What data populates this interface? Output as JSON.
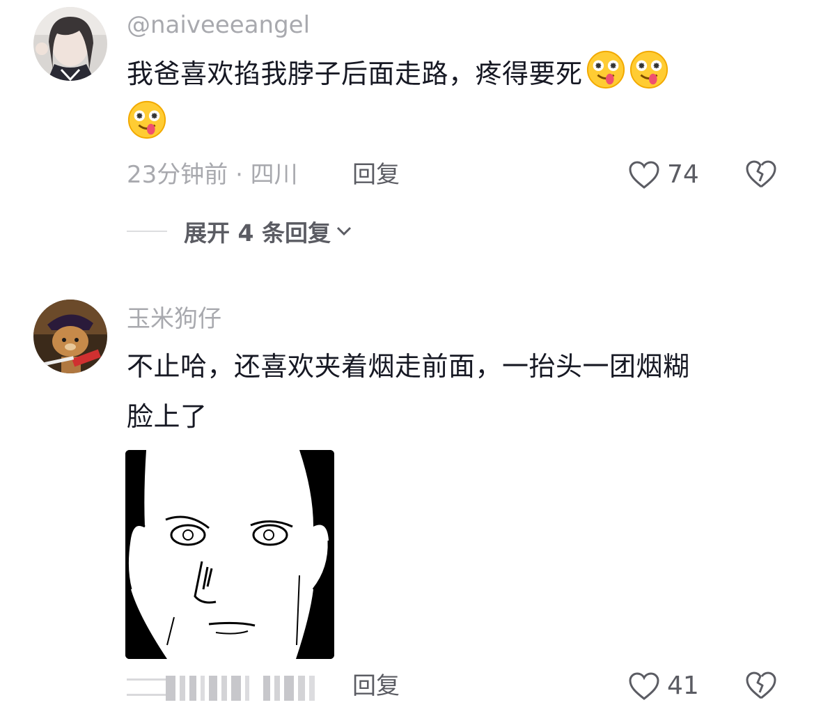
{
  "comments": [
    {
      "username": "@naiveeeangel",
      "text": "我爸喜欢掐我脖子后面走路，疼得要死",
      "emoji": [
        "drooling-face-emoji",
        "drooling-face-emoji",
        "drooling-face-emoji"
      ],
      "time_location": "23分钟前 · 四川",
      "reply_label": "回复",
      "likes": "74",
      "expand_replies": "展开 4 条回复"
    },
    {
      "username": "玉米狗仔",
      "text_line1": "不止哈，还喜欢夹着烟走前面，一抬头一团烟糊",
      "text_line2": "脸上了",
      "reply_label": "回复",
      "likes": "41"
    }
  ],
  "icons": {
    "like": "heart-outline-icon",
    "dislike": "broken-heart-icon",
    "expand": "chevron-down-icon"
  },
  "colors": {
    "text": "#161823",
    "muted": "#a8a9ae",
    "action": "#5b5c63"
  }
}
